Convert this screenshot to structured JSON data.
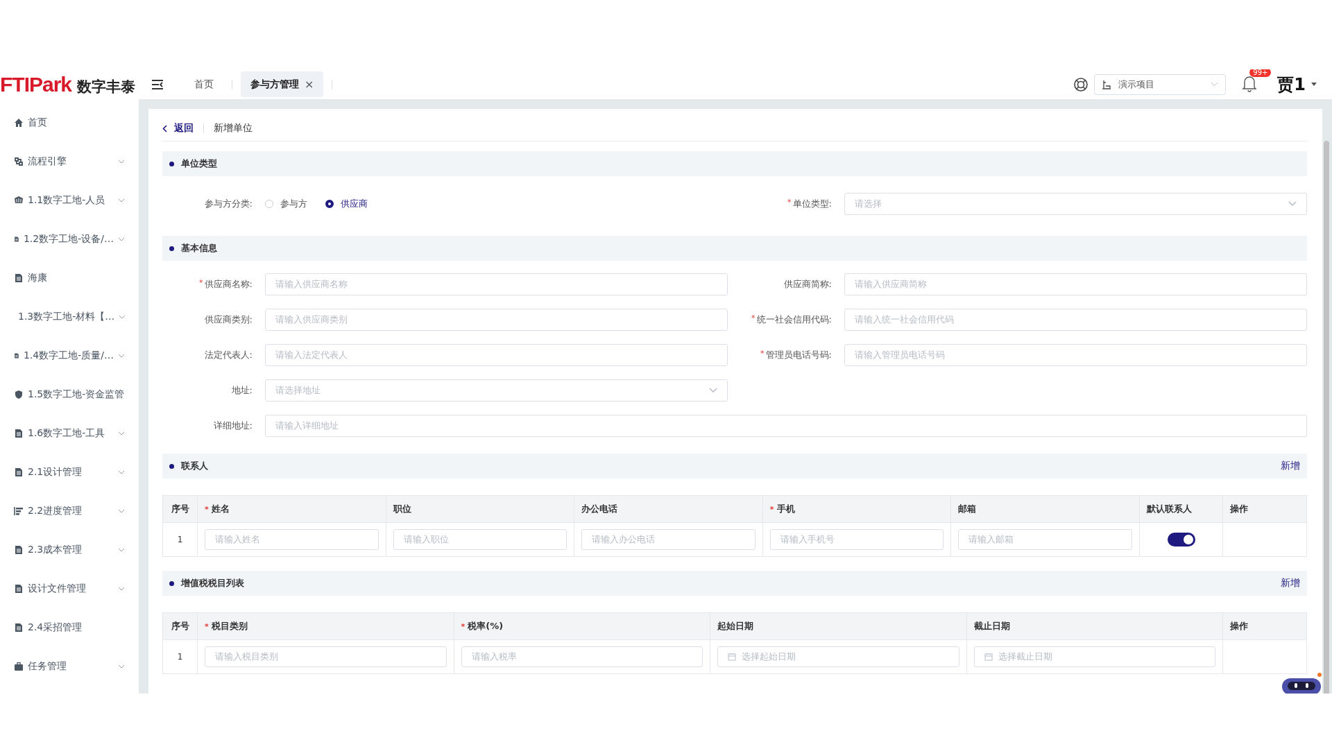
{
  "header": {
    "logo_text": "FTIPark",
    "logo_cn": "数字丰泰",
    "tabs": [
      {
        "label": "首页",
        "selected": false,
        "closable": false
      },
      {
        "label": "参与方管理",
        "selected": true,
        "closable": true
      }
    ],
    "close_glyph": "×",
    "project": "演示项目",
    "badge": "99+",
    "user": "贾1"
  },
  "sidebar": {
    "items": [
      {
        "label": "首页",
        "expandable": false
      },
      {
        "label": "流程引擎",
        "expandable": true
      },
      {
        "label": "1.1数字工地-人员",
        "expandable": true
      },
      {
        "label": "1.2数字工地-设备/…",
        "expandable": true
      },
      {
        "label": "海康",
        "expandable": false
      },
      {
        "label": "1.3数字工地-材料【…",
        "expandable": true
      },
      {
        "label": "1.4数字工地-质量/…",
        "expandable": true
      },
      {
        "label": "1.5数字工地-资金监管",
        "expandable": false
      },
      {
        "label": "1.6数字工地-工具",
        "expandable": true
      },
      {
        "label": "2.1设计管理",
        "expandable": true
      },
      {
        "label": "2.2进度管理",
        "expandable": true
      },
      {
        "label": "2.3成本管理",
        "expandable": true
      },
      {
        "label": "设计文件管理",
        "expandable": true
      },
      {
        "label": "2.4采招管理",
        "expandable": false
      },
      {
        "label": "任务管理",
        "expandable": true
      }
    ]
  },
  "breadcrumb": {
    "back": "返回",
    "title": "新增单位"
  },
  "unit_type": {
    "title": "单位类型",
    "category_label": "参与方分类:",
    "options": [
      {
        "label": "参与方",
        "selected": false
      },
      {
        "label": "供应商",
        "selected": true
      }
    ],
    "type_field": {
      "mark": "*",
      "label": "单位类型:",
      "placeholder": "请选择",
      "kind": "select"
    }
  },
  "basic_info": {
    "title": "基本信息",
    "rows": [
      [
        {
          "mark": "*",
          "label": "供应商名称:",
          "placeholder": "请输入供应商名称",
          "kind": "input"
        },
        {
          "label": "供应商简称:",
          "placeholder": "请输入供应商简称",
          "kind": "input"
        }
      ],
      [
        {
          "label": "供应商类别:",
          "placeholder": "请输入供应商类别",
          "kind": "input"
        },
        {
          "mark": "*",
          "label": "统一社会信用代码:",
          "placeholder": "请输入统一社会信用代码",
          "kind": "input"
        }
      ],
      [
        {
          "label": "法定代表人:",
          "placeholder": "请输入法定代表人",
          "kind": "input"
        },
        {
          "mark": "*",
          "label": "管理员电话号码:",
          "placeholder": "请输入管理员电话号码",
          "kind": "input"
        }
      ],
      [
        {
          "label": "地址:",
          "placeholder": "请选择地址",
          "kind": "select"
        }
      ]
    ],
    "address_detail": {
      "label": "详细地址:",
      "placeholder": "请输入详细地址"
    }
  },
  "contacts": {
    "title": "联系人",
    "add": "新增",
    "columns": [
      {
        "label": "序号"
      },
      {
        "mark": "*",
        "label": "姓名"
      },
      {
        "label": "职位"
      },
      {
        "label": "办公电话"
      },
      {
        "mark": "*",
        "label": "手机"
      },
      {
        "label": "邮箱"
      },
      {
        "label": "默认联系人"
      },
      {
        "label": "操作"
      }
    ],
    "rows": [
      {
        "cells": [
          {
            "kind": "text",
            "text": "1"
          },
          {
            "kind": "input",
            "placeholder": "请输入姓名"
          },
          {
            "kind": "input",
            "placeholder": "请输入职位"
          },
          {
            "kind": "input",
            "placeholder": "请输入办公电话"
          },
          {
            "kind": "input",
            "placeholder": "请输入手机号"
          },
          {
            "kind": "input",
            "placeholder": "请输入邮箱"
          },
          {
            "kind": "toggle",
            "on": true
          },
          {
            "kind": "empty"
          }
        ]
      }
    ]
  },
  "tax_items": {
    "title": "增值税税目列表",
    "add": "新增",
    "columns": [
      {
        "label": "序号"
      },
      {
        "mark": "*",
        "label": "税目类别"
      },
      {
        "mark": "*",
        "label": "税率(%)"
      },
      {
        "label": "起始日期"
      },
      {
        "label": "截止日期"
      },
      {
        "label": "操作"
      }
    ],
    "rows": [
      {
        "cells": [
          {
            "kind": "text",
            "text": "1"
          },
          {
            "kind": "input",
            "placeholder": "请输入税目类别"
          },
          {
            "kind": "input",
            "placeholder": "请输入税率"
          },
          {
            "kind": "date",
            "placeholder": "选择起始日期"
          },
          {
            "kind": "date",
            "placeholder": "选择截止日期"
          },
          {
            "kind": "empty"
          }
        ]
      }
    ]
  }
}
